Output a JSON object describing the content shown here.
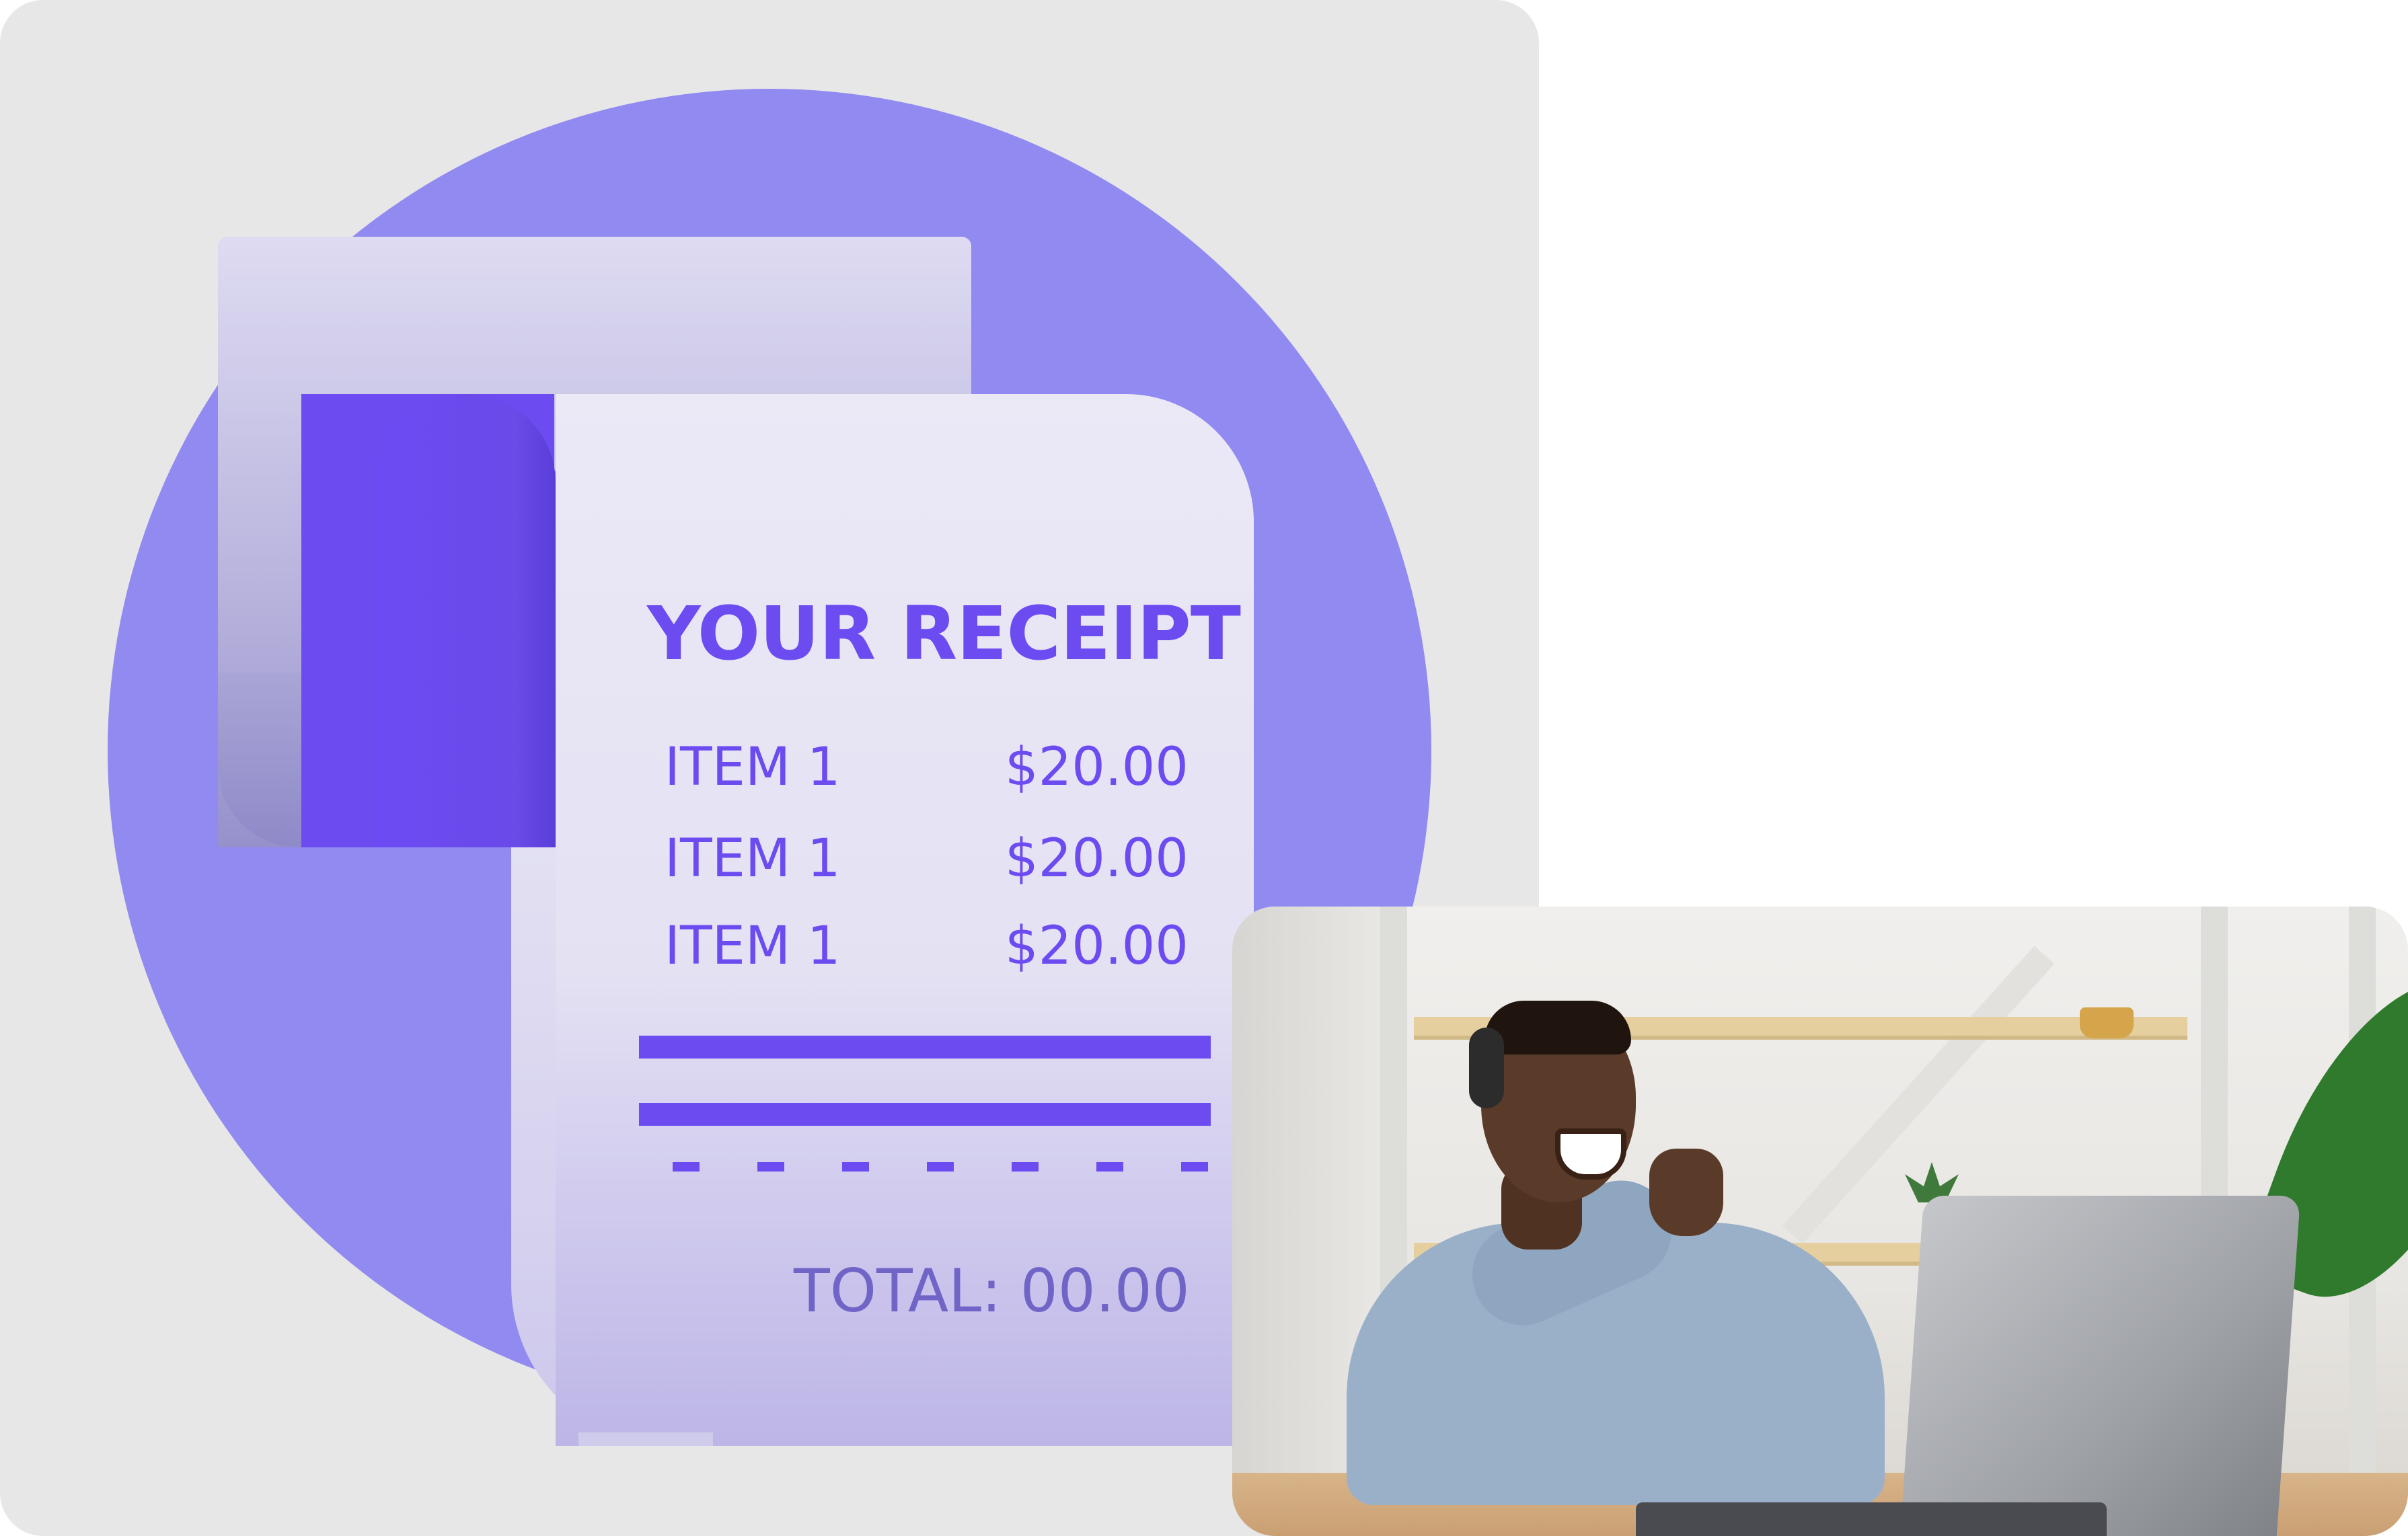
{
  "receipt": {
    "title": "YOUR RECEIPT",
    "items": [
      {
        "name": "ITEM 1",
        "price": "$20.00"
      },
      {
        "name": "ITEM 1",
        "price": "$20.00"
      },
      {
        "name": "ITEM 1",
        "price": "$20.00"
      }
    ],
    "total": "TOTAL: 00.00"
  },
  "photo": {
    "subject": "man-with-headset-thumbs-up-at-laptop"
  },
  "colors": {
    "background_card": "#e7e7e8",
    "circle": "#918af1",
    "accent": "#6c4bf1",
    "total_text": "#7065c7"
  }
}
